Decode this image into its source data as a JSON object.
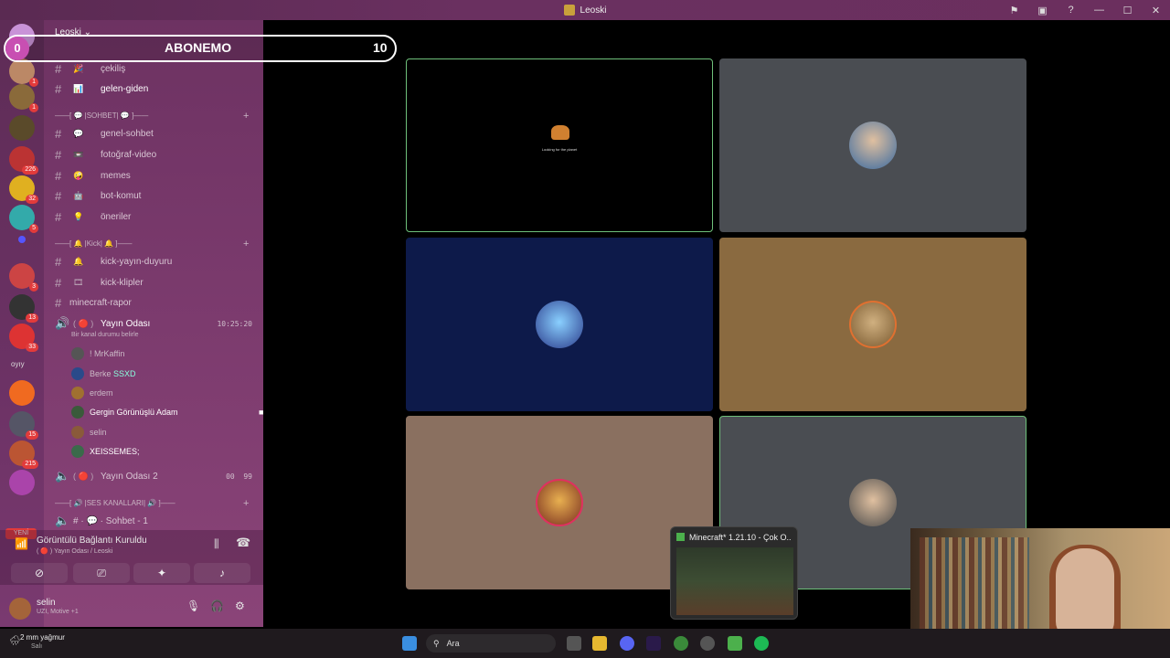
{
  "window": {
    "title": "Leoski"
  },
  "overlay": {
    "left_counter": "0",
    "title": "ABONEMO",
    "count": "10"
  },
  "server": {
    "name": "Leoski"
  },
  "rail": {
    "badges": [
      "1",
      "1",
      "226",
      "32",
      "5",
      "3",
      "13",
      "33",
      "15",
      "215"
    ],
    "text_item": "oyıy",
    "new_label": "YENİ"
  },
  "channels_top": [
    {
      "emoji": "🎉",
      "name": "çekiliş"
    },
    {
      "emoji": "📊",
      "name": "gelen-giden"
    }
  ],
  "category_sohbet": "——[ 💬 |SOHBET| 💬 ]——",
  "channels_sohbet": [
    {
      "emoji": "💬",
      "name": "genel-sohbet"
    },
    {
      "emoji": "📼",
      "name": "fotoğraf-video"
    },
    {
      "emoji": "🤪",
      "name": "memes"
    },
    {
      "emoji": "🤖",
      "name": "bot-komut"
    },
    {
      "emoji": "💡",
      "name": "öneriler"
    }
  ],
  "category_kick": "——[ 🔔 |Kick| 🔔 ]——",
  "channels_kick": [
    {
      "emoji": "🔔",
      "name": "kick-yayın-duyuru"
    },
    {
      "emoji": "🎞",
      "name": "kick-klipler"
    }
  ],
  "channel_minecraft": "minecraft-rapor",
  "voice_channel": {
    "name": "Yayın Odası",
    "time": "10:25:20",
    "status": "Bir kanal durumu belirle",
    "users": [
      {
        "name": "! MrKaffin"
      },
      {
        "name": "Berke",
        "tag": "SSXD"
      },
      {
        "name": "erdem"
      },
      {
        "name": "Gergin Görünüşlü Adam"
      },
      {
        "name": "selin"
      },
      {
        "name": "XEISSEMES;"
      }
    ]
  },
  "voice_channel_2": {
    "name": "Yayın Odası 2",
    "left": "00",
    "right": "99"
  },
  "category_ses": "——[ 🔊 |SES KANALLARI| 🔊 ]——",
  "channel_sohbet1": "# · 💬 · Sohbet - 1",
  "voice_panel": {
    "status": "Görüntülü Bağlantı Kuruldu",
    "sub": "( 🔴 ) Yayın Odası / Leoski"
  },
  "user": {
    "name": "selin",
    "status": "UZI, Motive +1"
  },
  "stage": {
    "tile1_note": "Looking for the planet"
  },
  "minecraft_popup": {
    "title": "Minecraft* 1.21.10 - Çok O..."
  },
  "taskbar": {
    "weather_temp": "2 mm yağmur",
    "weather_day": "Salı",
    "search_label": "Ara"
  }
}
